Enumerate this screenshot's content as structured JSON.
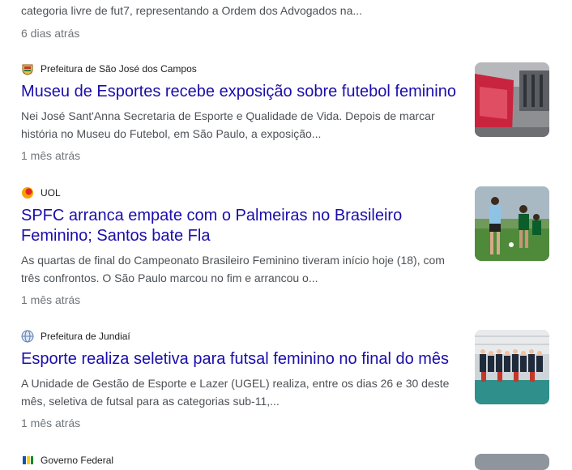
{
  "results": [
    {
      "snippet": "categoria livre de fut7, representando a Ordem dos Advogados na...",
      "date": "6 dias atrás"
    },
    {
      "source": "Prefeitura de São José dos Campos",
      "favicon": "city-crest-icon",
      "title": "Museu de Esportes recebe exposição sobre futebol feminino",
      "snippet": "Nei José Sant'Anna Secretaria de Esporte e Qualidade de Vida. Depois de marcar história no Museu do Futebol, em São Paulo, a exposição...",
      "date": "1 mês atrás"
    },
    {
      "source": "UOL",
      "favicon": "uol-logo-icon",
      "title": "SPFC arranca empate com o Palmeiras no Brasileiro Feminino; Santos bate Fla",
      "snippet": "As quartas de final do Campeonato Brasileiro Feminino tiveram início hoje (18), com três confrontos. O São Paulo marcou no fim e arrancou o...",
      "date": "1 mês atrás"
    },
    {
      "source": "Prefeitura de Jundiaí",
      "favicon": "globe-icon",
      "title": "Esporte realiza seletiva para futsal feminino no final do mês",
      "snippet": "A Unidade de Gestão de Esporte e Lazer (UGEL) realiza, entre os dias 26 e 30 deste mês, seletiva de futsal para as categorias sub-11,...",
      "date": "1 mês atrás"
    },
    {
      "source": "Governo Federal",
      "favicon": "gov-logo-icon"
    }
  ]
}
